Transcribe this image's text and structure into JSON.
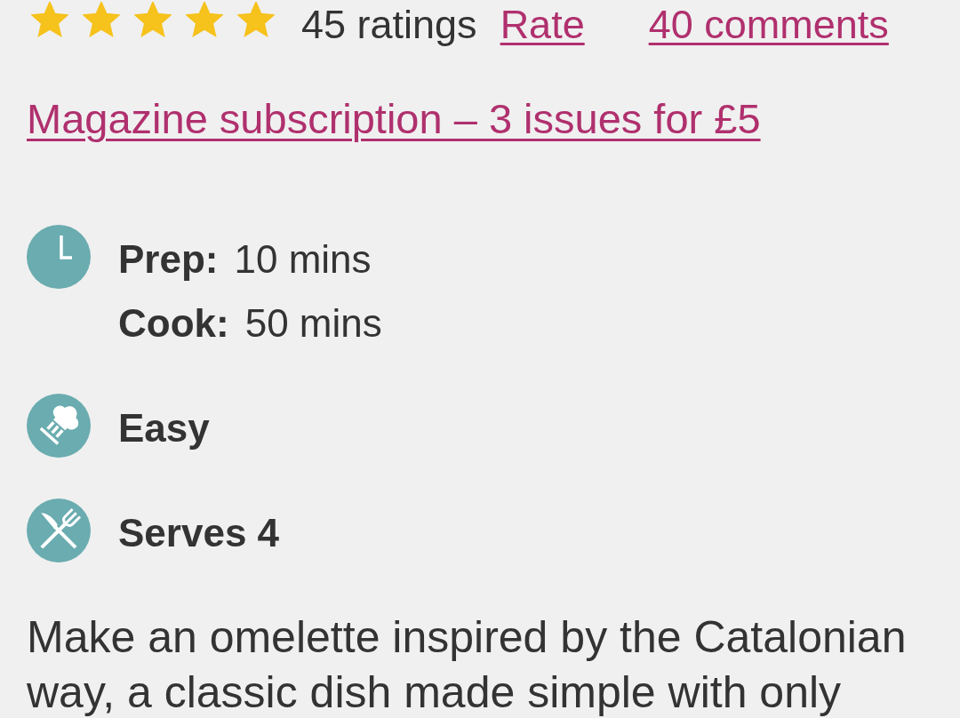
{
  "rating": {
    "stars": 5,
    "ratings_count": "45 ratings",
    "rate_link": "Rate",
    "comments_link": "40 comments"
  },
  "subscription_link": "Magazine subscription – 3 issues for £5",
  "details": [
    {
      "kind": "time",
      "lines": [
        {
          "label": "Prep:",
          "value": "10 mins"
        },
        {
          "label": "Cook:",
          "value": "50 mins"
        }
      ]
    },
    {
      "kind": "difficulty",
      "text": "Easy"
    },
    {
      "kind": "servings",
      "text": "Serves 4"
    }
  ],
  "description": "Make an omelette inspired by the Catalonian way, a classic dish made simple with only"
}
